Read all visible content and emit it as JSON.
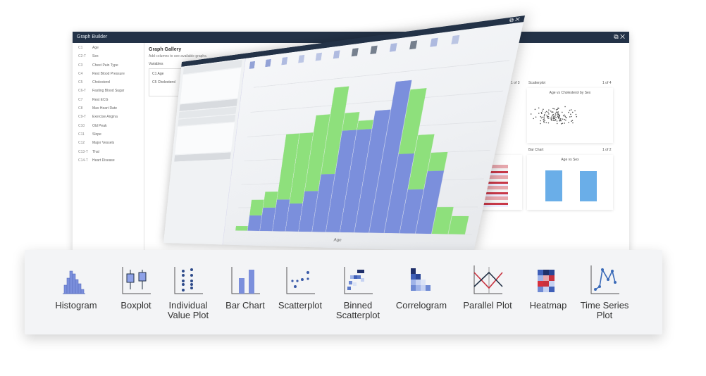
{
  "back_window": {
    "title": "Graph Builder",
    "controls": "⧉ ✕",
    "variables": [
      {
        "code": "C1",
        "name": "Age"
      },
      {
        "code": "C2-T",
        "name": "Sex"
      },
      {
        "code": "C3",
        "name": "Chest Pain Type"
      },
      {
        "code": "C4",
        "name": "Rest Blood Pressure"
      },
      {
        "code": "C5",
        "name": "Cholesterol"
      },
      {
        "code": "C6-T",
        "name": "Fasting Blood Sugar"
      },
      {
        "code": "C7",
        "name": "Rest ECG"
      },
      {
        "code": "C8",
        "name": "Max Heart Rate"
      },
      {
        "code": "C9-T",
        "name": "Exercise Angina"
      },
      {
        "code": "C10",
        "name": "Old Peak"
      },
      {
        "code": "C11",
        "name": "Slope"
      },
      {
        "code": "C12",
        "name": "Major Vessels"
      },
      {
        "code": "C13-T",
        "name": "Thal"
      },
      {
        "code": "C14-T",
        "name": "Heart Disease"
      }
    ],
    "gallery": {
      "title": "Graph Gallery",
      "subtitle": "Add columns to see available graphs.",
      "variables_label": "Variables",
      "chip1": "C1 Age",
      "chip2": "C5 Cholesterol"
    },
    "cards": {
      "scatter_header": "Scatterplot",
      "scatter_count": "1 of 4",
      "scatter_title": "Age vs Cholesterol by Sex",
      "bar_header": "Bar Chart",
      "bar_count": "1 of 2",
      "bar_title": "Age vs Sex",
      "left_count": "1 of 3"
    }
  },
  "front_window": {
    "controls": "⧉ ✕",
    "x_label": "Age",
    "colors": {
      "blue": "#7b8fdc",
      "green": "#8ee07c",
      "titlebar": "#233247"
    },
    "chart_data": {
      "type": "bar",
      "stacked": true,
      "series": [
        {
          "color": "#7b8fdc",
          "values": [
            0,
            2,
            3,
            4,
            3.5,
            5,
            7,
            12,
            12,
            14,
            17,
            9,
            5,
            7,
            0,
            0
          ]
        },
        {
          "color": "#8ee07c",
          "values": [
            0.6,
            2,
            2,
            8,
            8.5,
            9,
            10,
            2,
            1,
            0,
            0,
            7,
            6,
            2,
            3,
            2
          ]
        }
      ],
      "ylim": [
        0,
        18
      ]
    }
  },
  "gallery_strip": {
    "items": [
      {
        "label": "Histogram",
        "icon": "histogram-icon"
      },
      {
        "label": "Boxplot",
        "icon": "boxplot-icon"
      },
      {
        "label": "Individual Value Plot",
        "icon": "individual-value-plot-icon"
      },
      {
        "label": "Bar Chart",
        "icon": "bar-chart-icon"
      },
      {
        "label": "Scatterplot",
        "icon": "scatterplot-icon"
      },
      {
        "label": "Binned Scatterplot",
        "icon": "binned-scatterplot-icon"
      },
      {
        "label": "Correlogram",
        "icon": "correlogram-icon"
      },
      {
        "label": "Parallel Plot",
        "icon": "parallel-plot-icon"
      },
      {
        "label": "Heatmap",
        "icon": "heatmap-icon"
      },
      {
        "label": "Time Series Plot",
        "icon": "time-series-plot-icon"
      }
    ]
  }
}
